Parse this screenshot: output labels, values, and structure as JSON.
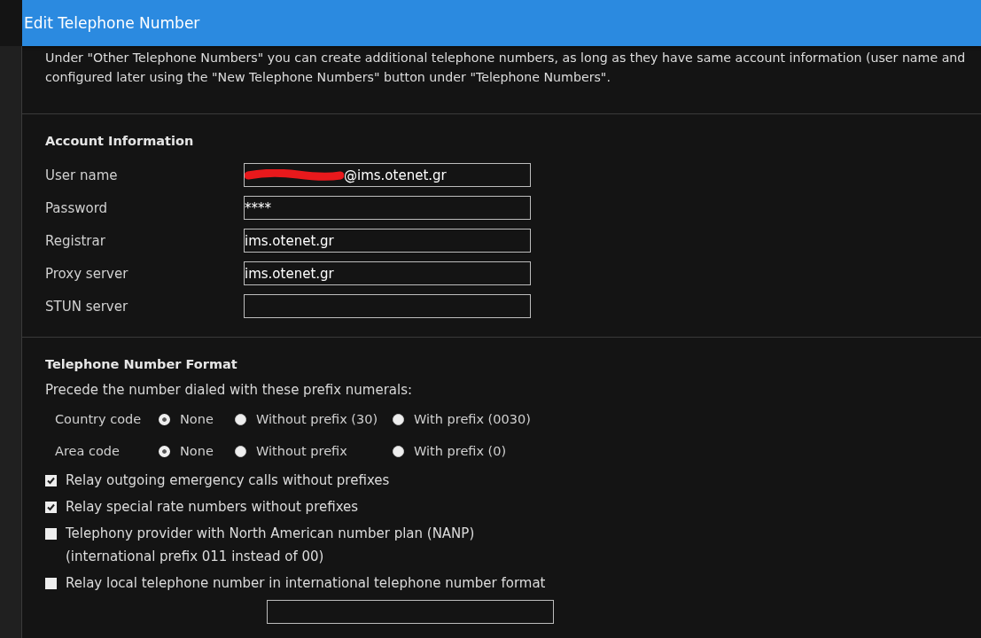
{
  "window": {
    "title": "Edit Telephone Number"
  },
  "intro": "Under \"Other Telephone Numbers\" you can create additional telephone numbers, as long as they have same account information (user name and",
  "intro_line2": "configured later using the \"New Telephone Numbers\" button under \"Telephone Numbers\".",
  "account": {
    "heading": "Account Information",
    "fields": [
      {
        "label": "User name",
        "value": "@ims.otenet.gr",
        "redacted": true
      },
      {
        "label": "Password",
        "value": "****",
        "redacted": false
      },
      {
        "label": "Registrar",
        "value": "ims.otenet.gr",
        "redacted": false
      },
      {
        "label": "Proxy server",
        "value": "ims.otenet.gr",
        "redacted": false
      },
      {
        "label": "STUN server",
        "redacted": false
      }
    ]
  },
  "format": {
    "heading": "Telephone Number Format",
    "hint": "Precede the number dialed with these prefix numerals:",
    "radio_groups": [
      {
        "label": "Country code",
        "options": [
          {
            "label": "None",
            "selected": true
          },
          {
            "label": "Without prefix (30)",
            "selected": false
          },
          {
            "label": "With prefix (0030)",
            "selected": false
          }
        ]
      },
      {
        "label": "Area code",
        "options": [
          {
            "label": "None",
            "selected": true
          },
          {
            "label": "Without prefix",
            "selected": false
          },
          {
            "label": "With prefix (0)",
            "selected": false
          }
        ]
      }
    ],
    "checkboxes": [
      {
        "label": "Relay outgoing emergency calls without prefixes",
        "checked": true
      },
      {
        "label": "Relay special rate numbers without prefixes",
        "checked": true
      },
      {
        "label": "Telephony provider with North American number plan (NANP)",
        "note": "(international prefix 011 instead of 00)",
        "checked": false
      },
      {
        "label": "Relay local telephone number in international telephone number format",
        "checked": false
      }
    ],
    "trailing": [
      {
        "kind": "field"
      }
    ]
  }
}
